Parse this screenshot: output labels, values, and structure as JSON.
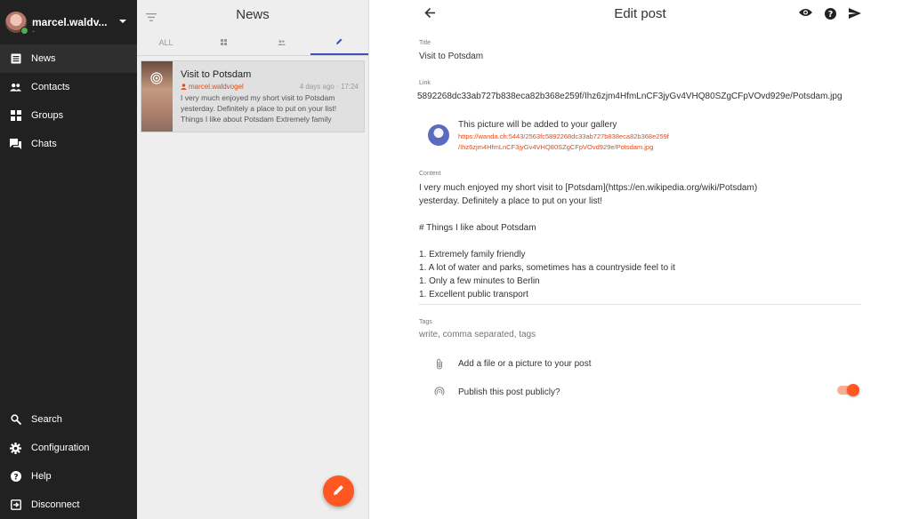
{
  "user": {
    "name": "marcel.waldv...",
    "sub": "-"
  },
  "sidebar": {
    "items": [
      {
        "label": "News",
        "icon": "news-icon"
      },
      {
        "label": "Contacts",
        "icon": "contacts-icon"
      },
      {
        "label": "Groups",
        "icon": "groups-icon"
      },
      {
        "label": "Chats",
        "icon": "chats-icon"
      }
    ],
    "bottom": [
      {
        "label": "Search",
        "icon": "search-icon"
      },
      {
        "label": "Configuration",
        "icon": "gear-icon"
      },
      {
        "label": "Help",
        "icon": "help-icon"
      },
      {
        "label": "Disconnect",
        "icon": "disconnect-icon"
      }
    ]
  },
  "list": {
    "title": "News",
    "tabs": [
      {
        "label": "ALL"
      },
      {
        "label": ""
      },
      {
        "label": ""
      },
      {
        "label": ""
      }
    ],
    "post": {
      "title": "Visit to Potsdam",
      "author": "marcel.waldvogel",
      "time": "4 days ago · 17:24",
      "excerpt": "I very much enjoyed my short visit to Potsdam yesterday. Definitely a place to put on your list! Things I like about Potsdam Extremely family"
    }
  },
  "editor": {
    "title": "Edit post",
    "title_label": "Title",
    "title_value": "Visit to Potsdam",
    "link_label": "Link",
    "link_value": "5892268dc33ab727b838eca82b368e259f/Ihz6zjm4HfmLnCF3jyGv4VHQ80SZgCFpVOvd929e/Potsdam.jpg",
    "gallery_title": "This picture will be added to your gallery",
    "gallery_link_1": "https://wanda.ch:5443/2563fc5892268dc33ab727b838eca82b368e259f",
    "gallery_link_2": "/Ihz6zjm4HfmLnCF3jyGv4VHQ80SZgCFpVOvd929e/Potsdam.jpg",
    "content_label": "Content",
    "content_value": "I very much enjoyed my short visit to [Potsdam](https://en.wikipedia.org/wiki/Potsdam)\nyesterday. Definitely a place to put on your list!\n\n# Things I like about Potsdam\n\n1. Extremely family friendly\n1. A lot of water and parks, sometimes has a countryside feel to it\n1. Only a few minutes to Berlin\n1. Excellent public transport",
    "tags_label": "Tags",
    "tags_placeholder": "write, comma separated, tags",
    "attach_label": "Add a file or a picture to your post",
    "publish_label": "Publish this post publicly?",
    "publish_on": true
  },
  "colors": {
    "accent": "#ff5722",
    "link": "#e64a19",
    "sidebar": "#212121",
    "tab_indicator": "#3f51b5"
  }
}
